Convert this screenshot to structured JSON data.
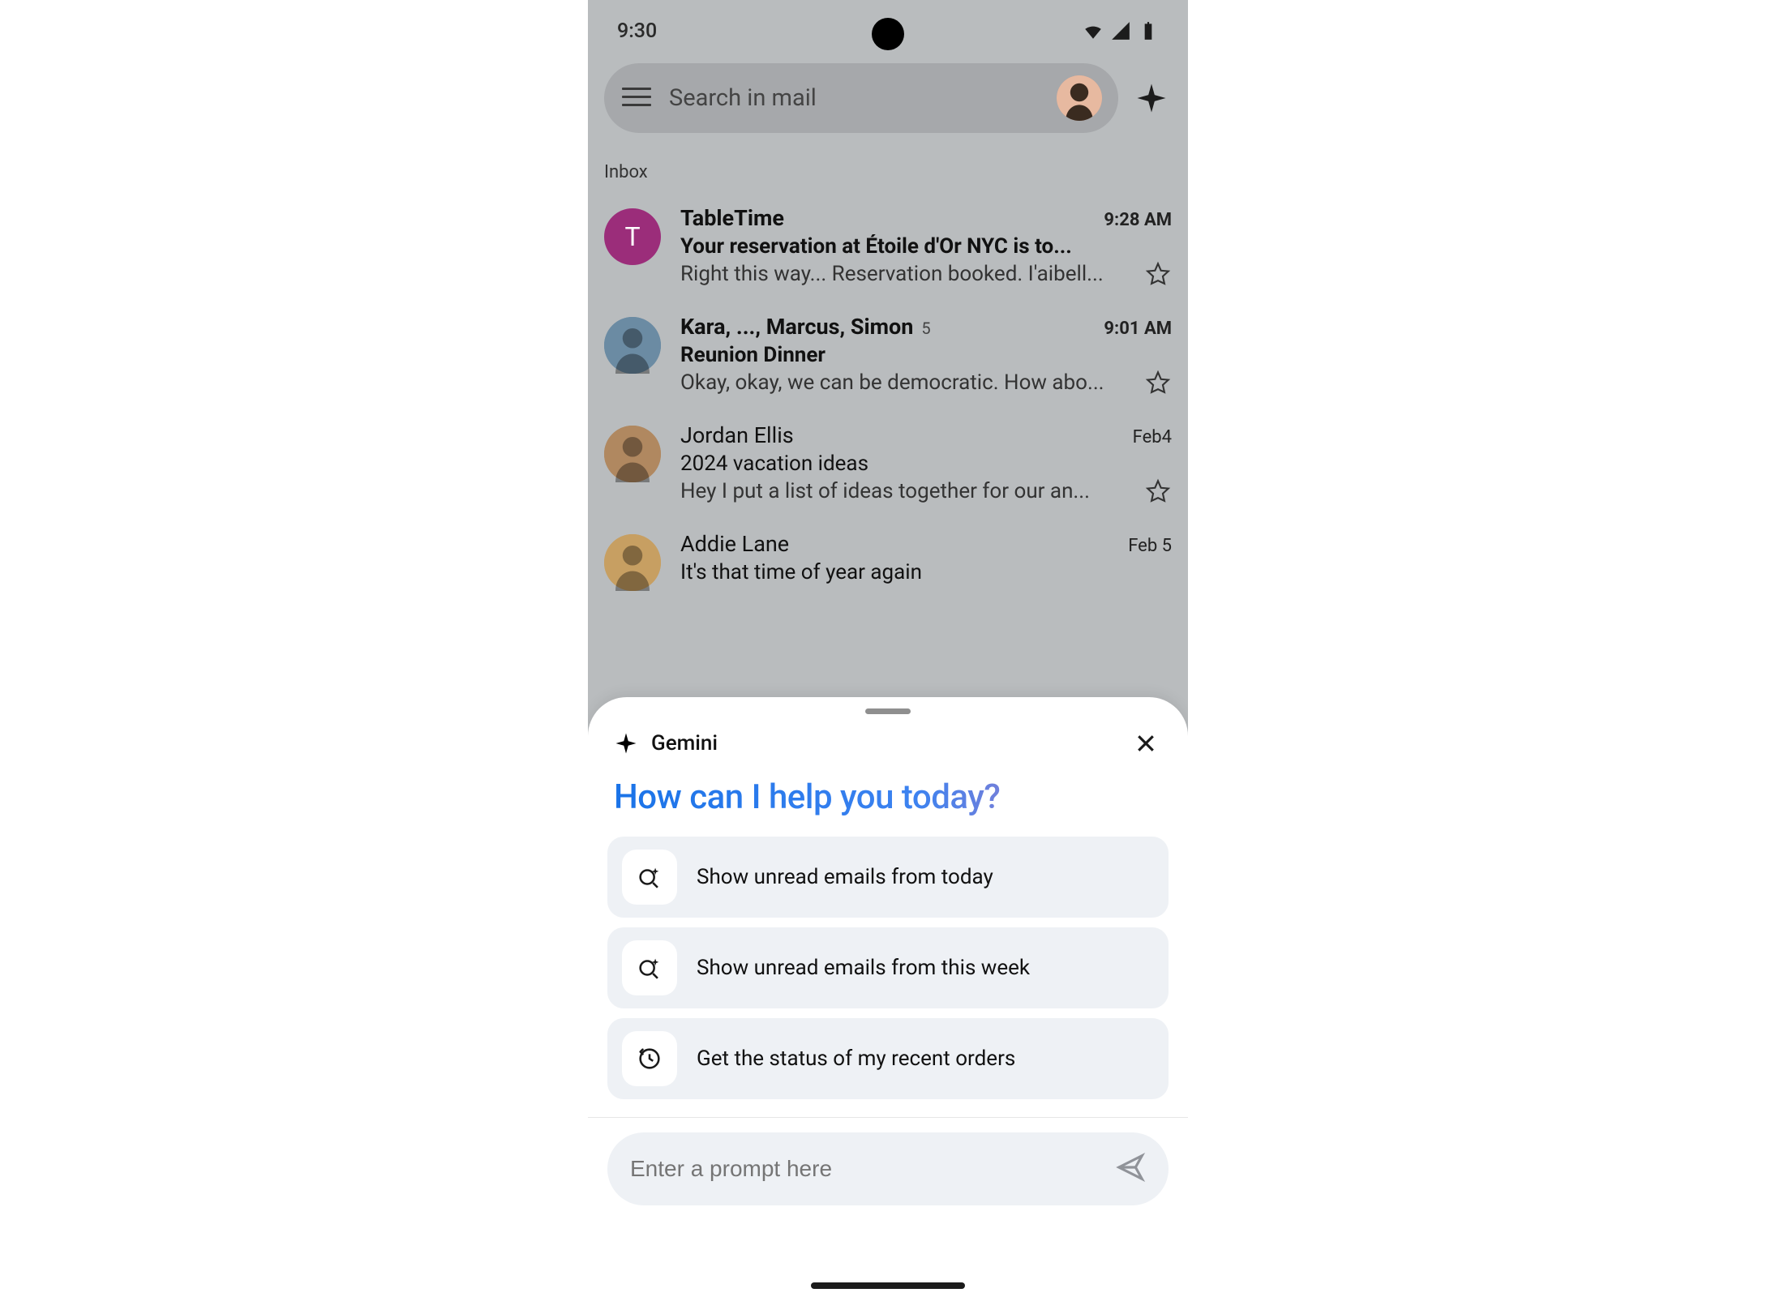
{
  "status": {
    "time": "9:30"
  },
  "search": {
    "placeholder": "Search in mail"
  },
  "section_label": "Inbox",
  "emails": [
    {
      "sender": "TableTime",
      "subject": "Your reservation at Étoile d'Or NYC is to...",
      "snippet": "Right this way... Reservation booked. I'aibell...",
      "time": "9:28 AM",
      "unread": true,
      "avatar_letter": "T",
      "avatar_color": "#9b2d7a",
      "thread_count": ""
    },
    {
      "sender": "Kara, ..., Marcus, Simon",
      "subject": "Reunion Dinner",
      "snippet": "Okay, okay, we can be democratic. How abo...",
      "time": "9:01 AM",
      "unread": true,
      "avatar_letter": "",
      "avatar_color": "#6b8ba3",
      "thread_count": "5"
    },
    {
      "sender": "Jordan Ellis",
      "subject": "2024 vacation ideas",
      "snippet": "Hey I put a list of ideas together for our an...",
      "time": "Feb4",
      "unread": false,
      "avatar_letter": "",
      "avatar_color": "#b08860",
      "thread_count": ""
    },
    {
      "sender": "Addie Lane",
      "subject": "It's that time of year again",
      "snippet": "",
      "time": "Feb 5",
      "unread": false,
      "avatar_letter": "",
      "avatar_color": "#c79f62",
      "thread_count": ""
    }
  ],
  "sheet": {
    "brand": "Gemini",
    "title": "How can I help you today?",
    "suggestions": [
      {
        "icon": "search-sparkle",
        "label": "Show unread emails from today"
      },
      {
        "icon": "search-sparkle",
        "label": "Show unread emails from this week"
      },
      {
        "icon": "clock-refresh",
        "label": "Get the status of my recent orders"
      }
    ],
    "prompt_placeholder": "Enter a prompt here"
  }
}
